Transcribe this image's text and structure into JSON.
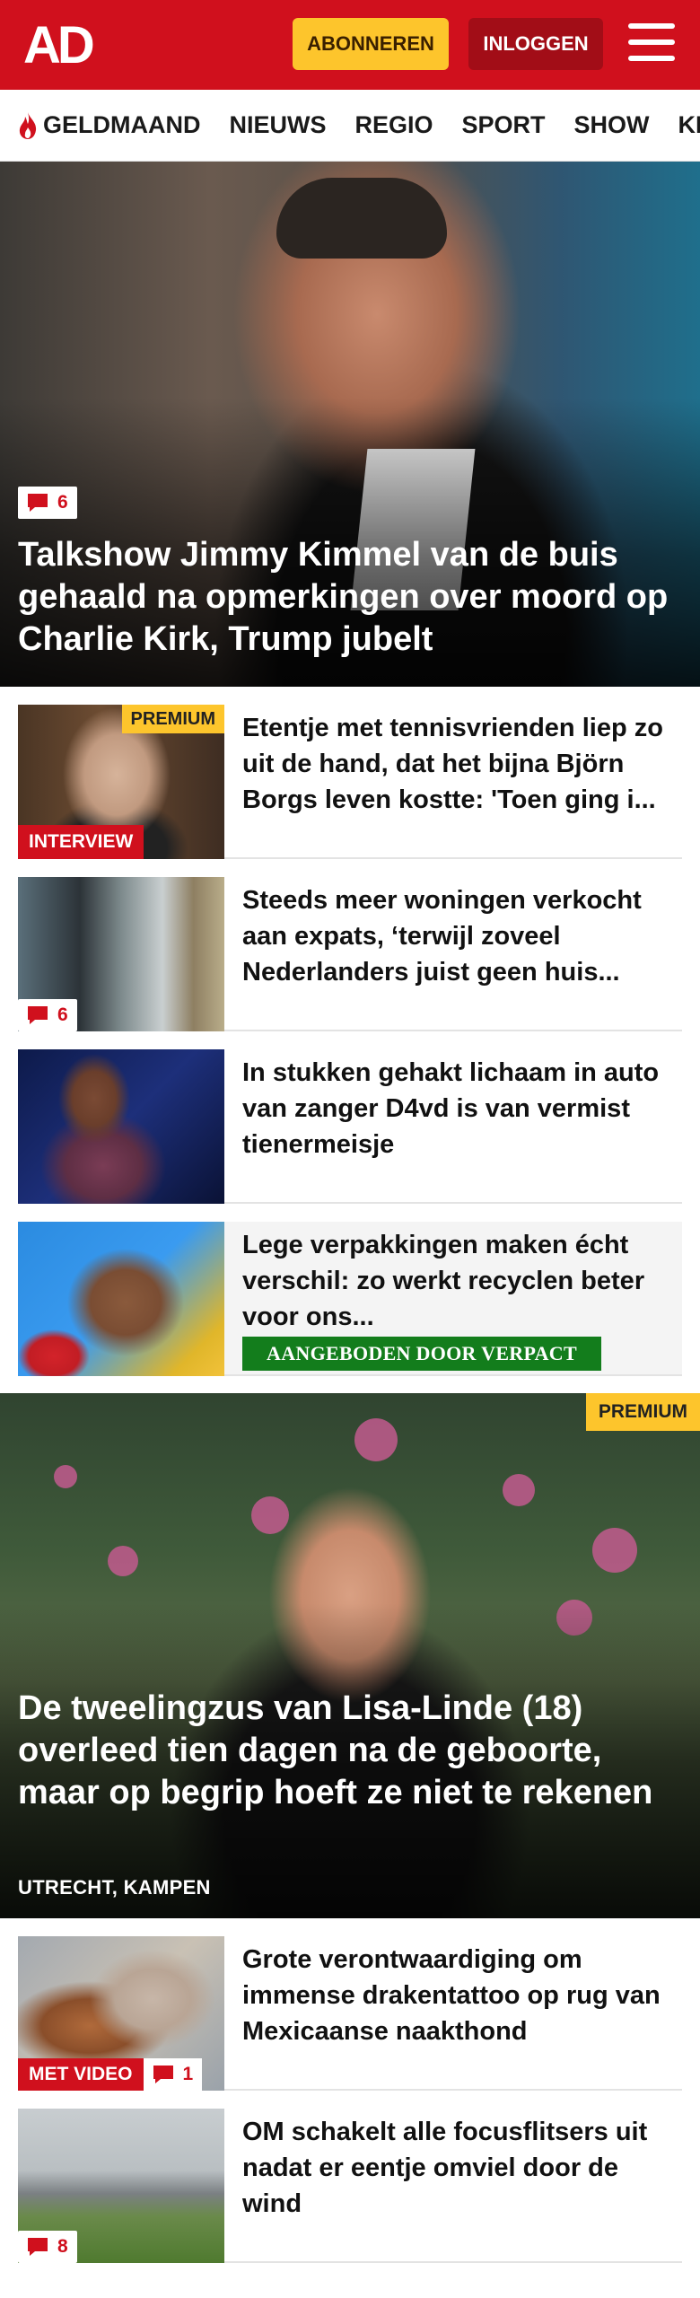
{
  "header": {
    "logo": "AD",
    "subscribe_label": "ABONNEREN",
    "login_label": "INLOGGEN"
  },
  "nav": {
    "items": [
      "GELDMAAND",
      "NIEUWS",
      "REGIO",
      "SPORT",
      "SHOW",
      "KIJK"
    ]
  },
  "hero": {
    "comments": "6",
    "title": "Talkshow Jimmy Kimmel van de buis gehaald na opmerkingen over moord op Charlie Kirk, Trump jubelt"
  },
  "articles": [
    {
      "title": "Etentje met tennisvrienden liep zo uit de hand, dat het bijna Björn Borgs leven kostte: 'Toen ging i...",
      "premium_label": "PREMIUM",
      "label": "INTERVIEW"
    },
    {
      "title": "Steeds meer woningen verkocht aan expats, ‘terwijl zoveel Nederlanders juist geen huis...",
      "comments": "6"
    },
    {
      "title": "In stukken gehakt lichaam in auto van zanger D4vd is van vermist tienermeisje"
    },
    {
      "title": "Lege verpakkingen maken écht verschil: zo werkt recyclen beter voor ons...",
      "sponsor": "AANGEBODEN DOOR VERPACT"
    }
  ],
  "feature": {
    "premium_label": "PREMIUM",
    "title": "De tweelingzus van Lisa-Linde (18) overleed tien dagen na de geboorte, maar op begrip hoeft ze niet te rekenen",
    "location": "UTRECHT, KAMPEN"
  },
  "articles2": [
    {
      "title": "Grote verontwaardiging om immense drakentattoo op rug van Mexicaanse naakthond",
      "label": "MET VIDEO",
      "comments": "1"
    },
    {
      "title": "OM schakelt alle focusflitsers uit nadat er eentje omviel door de wind",
      "comments": "8"
    }
  ],
  "colors": {
    "brand_red": "#d0101d",
    "premium_yellow": "#fdc52c",
    "sponsor_green": "#137d1c"
  },
  "icons": [
    "flame-icon",
    "menu-icon",
    "comment-icon"
  ]
}
